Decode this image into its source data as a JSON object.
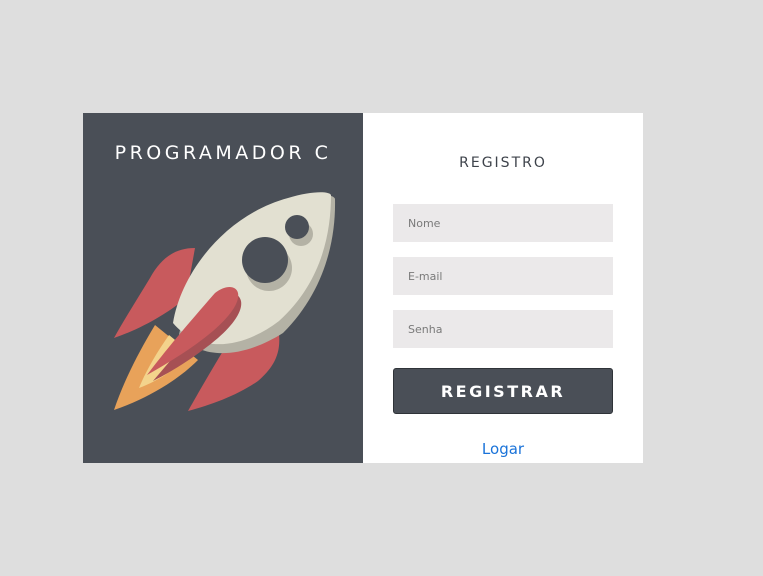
{
  "brand": {
    "title": "PROGRAMADOR C",
    "illustration": "rocket-icon"
  },
  "form": {
    "title": "REGISTRO",
    "fields": {
      "name": {
        "placeholder": "Nome",
        "value": ""
      },
      "email": {
        "placeholder": "E-mail",
        "value": ""
      },
      "password": {
        "placeholder": "Senha",
        "value": ""
      }
    },
    "submit_label": "REGISTRAR",
    "login_link_label": "Logar"
  },
  "colors": {
    "page_background": "#dedede",
    "brand_panel": "#4a4f57",
    "button": "#4a4f57",
    "link": "#1a73d9",
    "input_background": "#ebe9ea",
    "rocket_body": "#e2e0d1",
    "rocket_fins": "#c85a5d",
    "flame_outer": "#e8a25a",
    "flame_inner": "#f3d38c"
  }
}
